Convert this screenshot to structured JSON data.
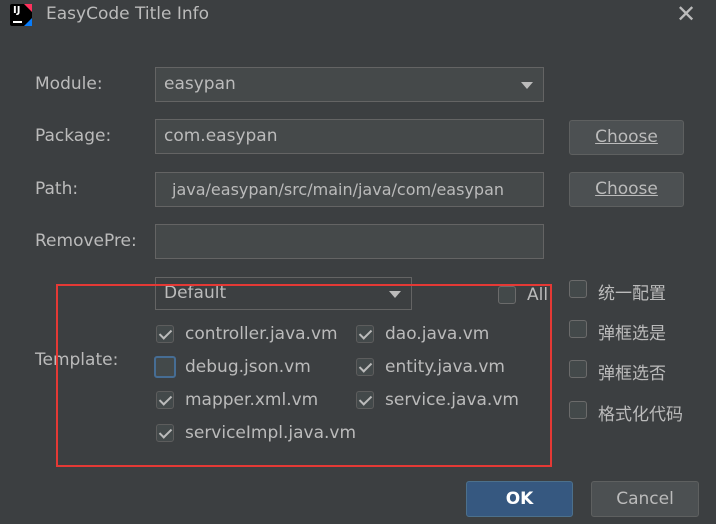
{
  "window": {
    "title": "EasyCode Title Info",
    "close_symbol": "✕"
  },
  "form": {
    "module": {
      "label": "Module:",
      "value": "easypan"
    },
    "package": {
      "label": "Package:",
      "value": "com.easypan",
      "button": "Choose"
    },
    "path": {
      "label": "Path:",
      "value": "java/easypan/src/main/java/com/easypan",
      "button": "Choose"
    },
    "removepre": {
      "label": "RemovePre:",
      "value": ""
    },
    "template": {
      "label": "Template:",
      "group_value": "Default",
      "all_label": "All",
      "all_checked": false,
      "items": [
        {
          "label": "controller.java.vm",
          "checked": true
        },
        {
          "label": "dao.java.vm",
          "checked": true
        },
        {
          "label": "debug.json.vm",
          "checked": false
        },
        {
          "label": "entity.java.vm",
          "checked": true
        },
        {
          "label": "mapper.xml.vm",
          "checked": true
        },
        {
          "label": "service.java.vm",
          "checked": true
        },
        {
          "label": "serviceImpl.java.vm",
          "checked": true
        }
      ]
    }
  },
  "options": [
    {
      "label": "统一配置",
      "checked": false
    },
    {
      "label": "弹框选是",
      "checked": false
    },
    {
      "label": "弹框选否",
      "checked": false
    },
    {
      "label": "格式化代码",
      "checked": false
    }
  ],
  "footer": {
    "ok": "OK",
    "cancel": "Cancel"
  },
  "colors": {
    "background": "#3c3f41",
    "highlight_box": "#e53935",
    "primary_button": "#365880"
  }
}
